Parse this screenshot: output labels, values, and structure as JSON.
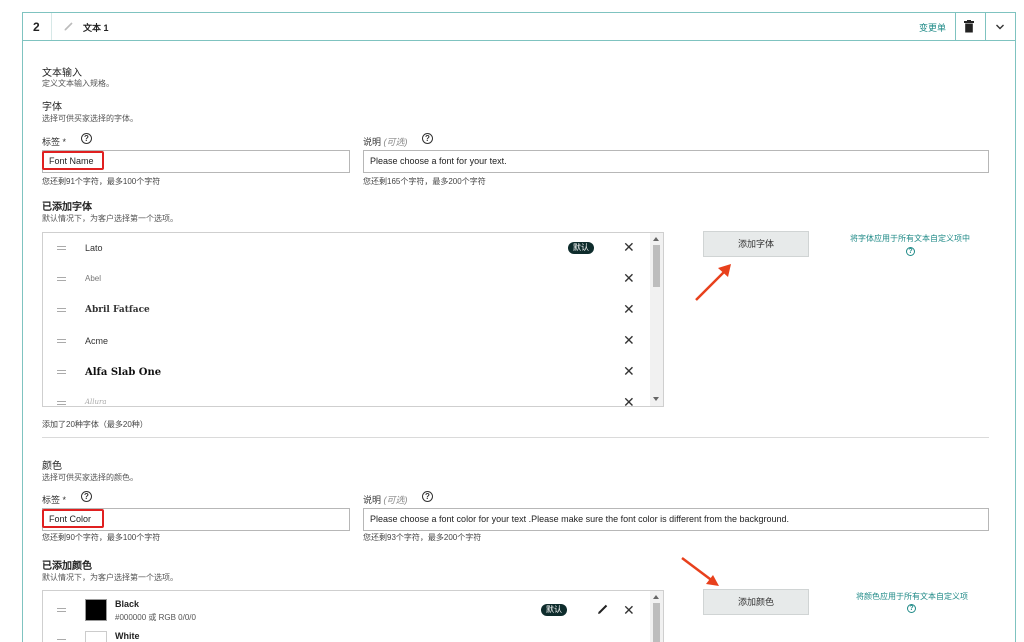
{
  "header": {
    "number": "2",
    "title": "文本 1",
    "change_label": "变更单"
  },
  "text_input": {
    "title": "文本输入",
    "desc": "定义文本输入规格。"
  },
  "font": {
    "title": "字体",
    "desc": "选择可供买家选择的字体。",
    "label_label": "标签 *",
    "label_value": "Font Name",
    "label_count": "您还剩91个字符，最多100个字符",
    "note_label": "说明",
    "note_optional": "(可选)",
    "note_value": "Please choose a font for your text.",
    "note_count": "您还剩165个字符，最多200个字符",
    "added_title": "已添加字体",
    "added_desc": "默认情况下，为客户选择第一个选项。",
    "items": [
      {
        "name": "Lato",
        "badge": "默认",
        "remove": "✕"
      },
      {
        "name": "Abel",
        "remove": "✕"
      },
      {
        "name": "Abril Fatface",
        "remove": "✕"
      },
      {
        "name": "Acme",
        "remove": "✕"
      },
      {
        "name": "Alfa Slab One",
        "remove": "✕"
      },
      {
        "name": "Allura",
        "remove": "✕"
      }
    ],
    "add_button": "添加字体",
    "apply_link": "将字体应用于所有文本自定义项中",
    "added_count": "添加了20种字体（最多20种）"
  },
  "color": {
    "title": "颜色",
    "desc": "选择可供买家选择的颜色。",
    "label_label": "标签 *",
    "label_value": "Font Color",
    "label_count": "您还剩90个字符，最多100个字符",
    "note_label": "说明",
    "note_optional": "(可选)",
    "note_value": "Please choose a font color for your text .Please make sure the font color is different from the background.",
    "note_count": "您还剩93个字符，最多200个字符",
    "added_title": "已添加颜色",
    "added_desc": "默认情况下，为客户选择第一个选项。",
    "items": [
      {
        "name": "Black",
        "detail": "#000000 或 RGB 0/0/0",
        "badge": "默认",
        "swatch": "#000000",
        "remove": "✕"
      },
      {
        "name": "White",
        "swatch": "#ffffff"
      }
    ],
    "add_button": "添加颜色",
    "apply_link": "将颜色应用于所有文本自定义项"
  },
  "icons": {
    "help": "?",
    "chevron": "chevron-down-icon",
    "trash": "trash-icon",
    "pencil": "pencil-icon"
  },
  "colors": {
    "accent": "#1f8a87",
    "border": "#7fc3c0",
    "highlight": "#e02020",
    "badge": "#0e2c2c"
  }
}
